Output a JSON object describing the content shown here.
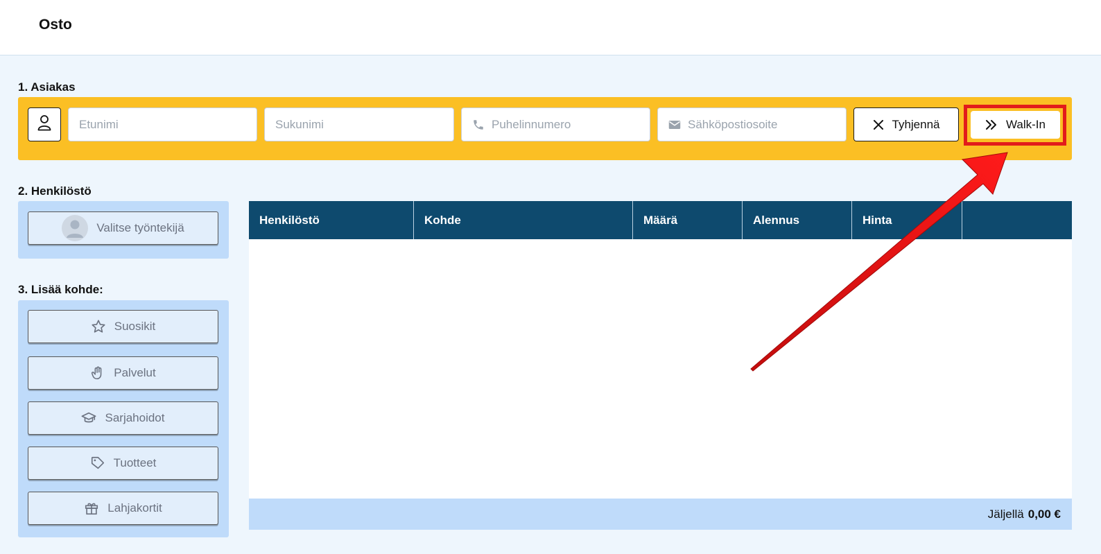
{
  "header": {
    "title": "Osto"
  },
  "sections": {
    "customer": "1. Asiakas",
    "staff": "2. Henkilöstö",
    "add_item": "3. Lisää kohde:"
  },
  "customer": {
    "first_name_placeholder": "Etunimi",
    "last_name_placeholder": "Sukunimi",
    "phone_placeholder": "Puhelinnumero",
    "email_placeholder": "Sähköpostiosoite",
    "clear_label": "Tyhjennä",
    "walkin_label": "Walk-In"
  },
  "staff": {
    "select_label": "Valitse työntekijä"
  },
  "items": {
    "favorites": "Suosikit",
    "services": "Palvelut",
    "series": "Sarjahoidot",
    "products": "Tuotteet",
    "giftcards": "Lahjakortit"
  },
  "table": {
    "columns": [
      "Henkilöstö",
      "Kohde",
      "Määrä",
      "Alennus",
      "Hinta",
      ""
    ],
    "rows": [],
    "footer_label": "Jäljellä",
    "footer_amount": "0,00 €"
  },
  "colors": {
    "customer_bar": "#fbbf24",
    "table_header": "#0e4a6e",
    "panel": "#bfdbfa",
    "highlight": "#e21b1b"
  }
}
